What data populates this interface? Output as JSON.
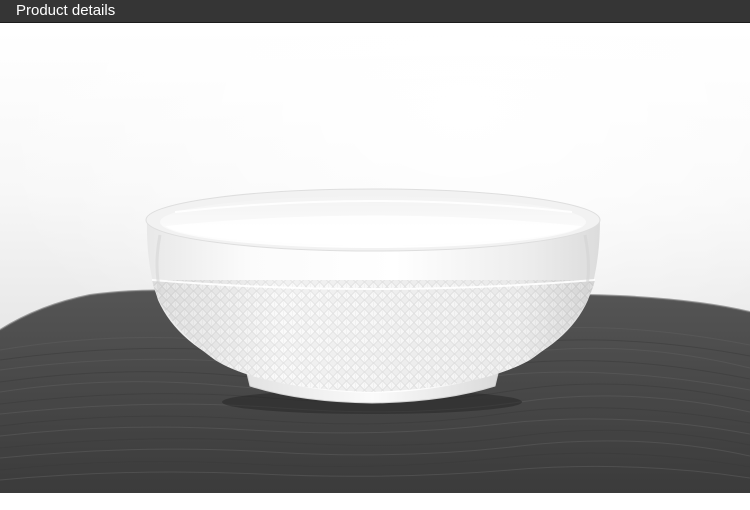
{
  "header": {
    "title": "Product details"
  },
  "photo": {
    "subject": "white-porcelain-bowl-icon",
    "colors": {
      "header_bg": "#353535",
      "header_text": "#ffffff",
      "backdrop": "#f4f4f4",
      "cloth": "#4a4a4a",
      "bowl": "#f6f6f6"
    }
  }
}
